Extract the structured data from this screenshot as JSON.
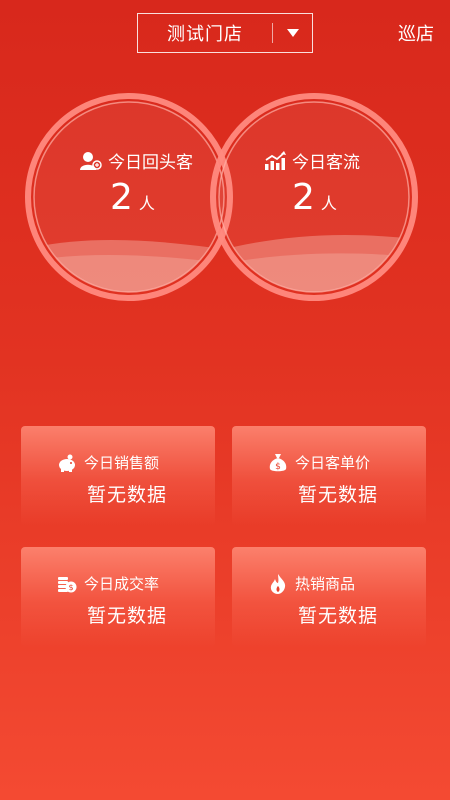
{
  "header": {
    "store_name": "测试门店",
    "patrol_label": "巡店"
  },
  "stats": {
    "returning_label": "今日回头客",
    "returning_value": "2",
    "returning_unit": "人",
    "traffic_label": "今日客流",
    "traffic_value": "2",
    "traffic_unit": "人"
  },
  "cards": [
    {
      "title": "今日销售额",
      "value": "暂无数据",
      "icon": "piggy-bank-icon"
    },
    {
      "title": "今日客单价",
      "value": "暂无数据",
      "icon": "money-bag-icon"
    },
    {
      "title": "今日成交率",
      "value": "暂无数据",
      "icon": "coins-icon"
    },
    {
      "title": "热销商品",
      "value": "暂无数据",
      "icon": "fire-icon"
    }
  ],
  "colors": {
    "background_top": "#d8281c",
    "background_bottom": "#f44a32",
    "ring": "#ff7f78"
  }
}
